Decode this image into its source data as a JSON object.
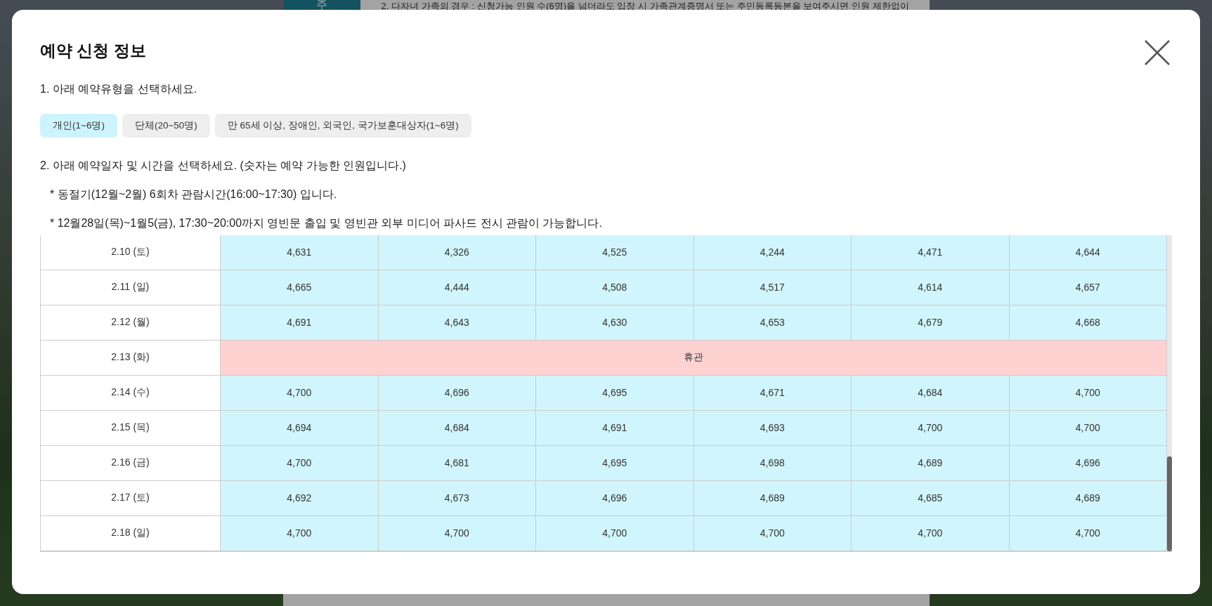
{
  "background_page": {
    "tab": "주",
    "notice": "2. 다자녀 가족의 경우 : 신청가능 인원 수(6명)을 넘더라도 입장 시 가족관계증명서 또는 주민등록등본을 보여주시면 인원 제한없이"
  },
  "dialog": {
    "title": "예약 신청 정보",
    "step1": "1. 아래 예약유형을 선택하세요.",
    "types": [
      {
        "label": "개인(1~6명)",
        "selected": true
      },
      {
        "label": "단체(20~50명)",
        "selected": false
      },
      {
        "label": "만 65세 이상, 장애인, 외국인, 국가보훈대상자(1~6명)",
        "selected": false
      }
    ],
    "step2": "2. 아래 예약일자 및 시간을 선택하세요. (숫자는 예약 가능한 인원입니다.)",
    "notes": [
      "* 동절기(12월~2월) 6회차 관람시간(16:00~17:30) 입니다.",
      "* 12월28일(목)~1월5(금), 17:30~20:00까지 영빈문 출입 및 영빈관 외부 미디어 파사드 전시 관람이 가능합니다."
    ],
    "rows": [
      {
        "kind": "open",
        "date": "2.10 (토)",
        "values": [
          "4,631",
          "4,326",
          "4,525",
          "4,244",
          "4,471",
          "4,644"
        ]
      },
      {
        "kind": "open",
        "date": "2.11 (일)",
        "values": [
          "4,665",
          "4,444",
          "4,508",
          "4,517",
          "4,614",
          "4,657"
        ]
      },
      {
        "kind": "open",
        "date": "2.12 (월)",
        "values": [
          "4,691",
          "4,643",
          "4,630",
          "4,653",
          "4,679",
          "4,668"
        ]
      },
      {
        "kind": "closed",
        "date": "2.13 (화)",
        "label": "휴관"
      },
      {
        "kind": "open",
        "date": "2.14 (수)",
        "values": [
          "4,700",
          "4,696",
          "4,695",
          "4,671",
          "4,684",
          "4,700"
        ]
      },
      {
        "kind": "open",
        "date": "2.15 (목)",
        "values": [
          "4,694",
          "4,684",
          "4,691",
          "4,693",
          "4,700",
          "4,700"
        ]
      },
      {
        "kind": "open",
        "date": "2.16 (금)",
        "values": [
          "4,700",
          "4,681",
          "4,695",
          "4,698",
          "4,689",
          "4,696"
        ]
      },
      {
        "kind": "open",
        "date": "2.17 (토)",
        "values": [
          "4,692",
          "4,673",
          "4,696",
          "4,689",
          "4,685",
          "4,689"
        ]
      },
      {
        "kind": "open",
        "date": "2.18 (일)",
        "values": [
          "4,700",
          "4,700",
          "4,700",
          "4,700",
          "4,700",
          "4,700"
        ]
      }
    ]
  }
}
